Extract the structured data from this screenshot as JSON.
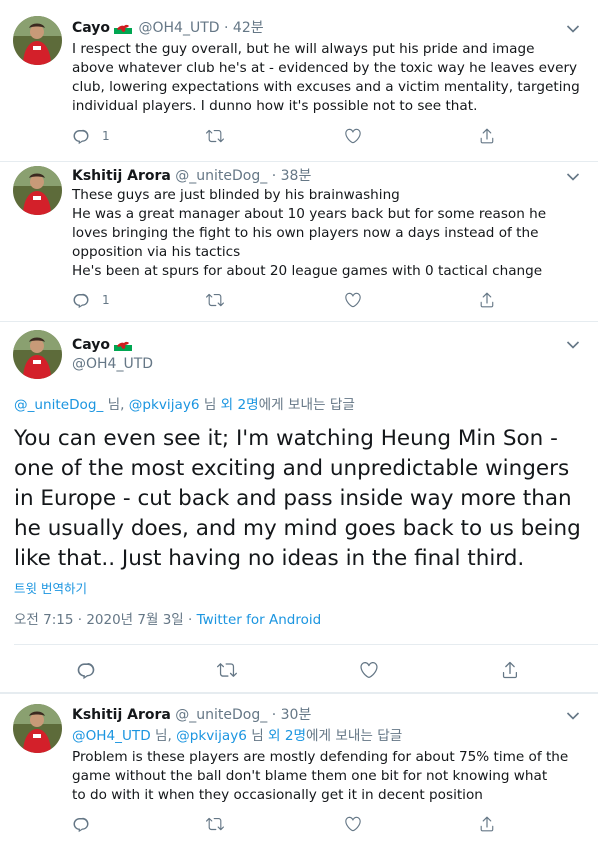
{
  "tweets": [
    {
      "name": "Cayo",
      "handle": "@OH4_UTD",
      "dot": "·",
      "time": "42분",
      "lines": [
        "I respect the guy overall, but he will always put his pride and image",
        "above whatever club he's at - evidenced by the toxic way he leaves every",
        "club, lowering expectations with excuses and a victim mentality, targeting",
        "individual players. I dunno how it's possible not to see that."
      ],
      "reply_count": "1"
    },
    {
      "name": "Kshitij Arora",
      "handle": "@_uniteDog_",
      "dot": "·",
      "time": "38분",
      "lines": [
        "These guys are just blinded by his brainwashing",
        "He was a great manager about 10 years back but for some reason he",
        "loves bringing the fight  to his own players now a days instead of the",
        "opposition via his tactics",
        "He's been at spurs for about 20 league games with 0 tactical change"
      ],
      "reply_count": "1"
    }
  ],
  "focus": {
    "name": "Cayo",
    "handle": "@OH4_UTD",
    "replying_to_1": "@_uniteDog_",
    "replying_sep": " 님, ",
    "replying_to_2": "@pkvijay6",
    "replying_mid": " 님 ",
    "replying_others": "외 2명",
    "replying_suffix": "에게 보내는 답글",
    "lines": [
      "You can even see it; I'm watching Heung Min Son -",
      "one of the most exciting and unpredictable wingers",
      "in Europe - cut back and pass inside way more than",
      "he usually does, and my mind goes back to us being",
      "like that.. Just having no ideas in the final third."
    ],
    "translate": "트윗 번역하기",
    "timestamp": "오전 7:15 · 2020년 7월 3일 · ",
    "source": "Twitter for Android"
  },
  "reply": {
    "name": "Kshitij Arora",
    "handle": "@_uniteDog_",
    "dot": "·",
    "time": "30분",
    "replying_to_1": "@OH4_UTD",
    "replying_sep": " 님, ",
    "replying_to_2": "@pkvijay6",
    "replying_mid": " 님 ",
    "replying_others": "외 2명",
    "replying_suffix": "에게 보내는 답글",
    "lines": [
      "Problem is these players are mostly defending for about 75% time of the",
      "game  without the ball don't blame them one bit for not knowing what",
      "to do with it when they occasionally get it in decent position"
    ]
  },
  "colors": {
    "accent": "#1b95e0",
    "muted": "#657786",
    "text": "#14171a",
    "border": "#e6ecf0"
  },
  "icons": [
    "reply-icon",
    "retweet-icon",
    "like-icon",
    "share-icon",
    "chevron-down-icon",
    "wales-flag-icon"
  ]
}
